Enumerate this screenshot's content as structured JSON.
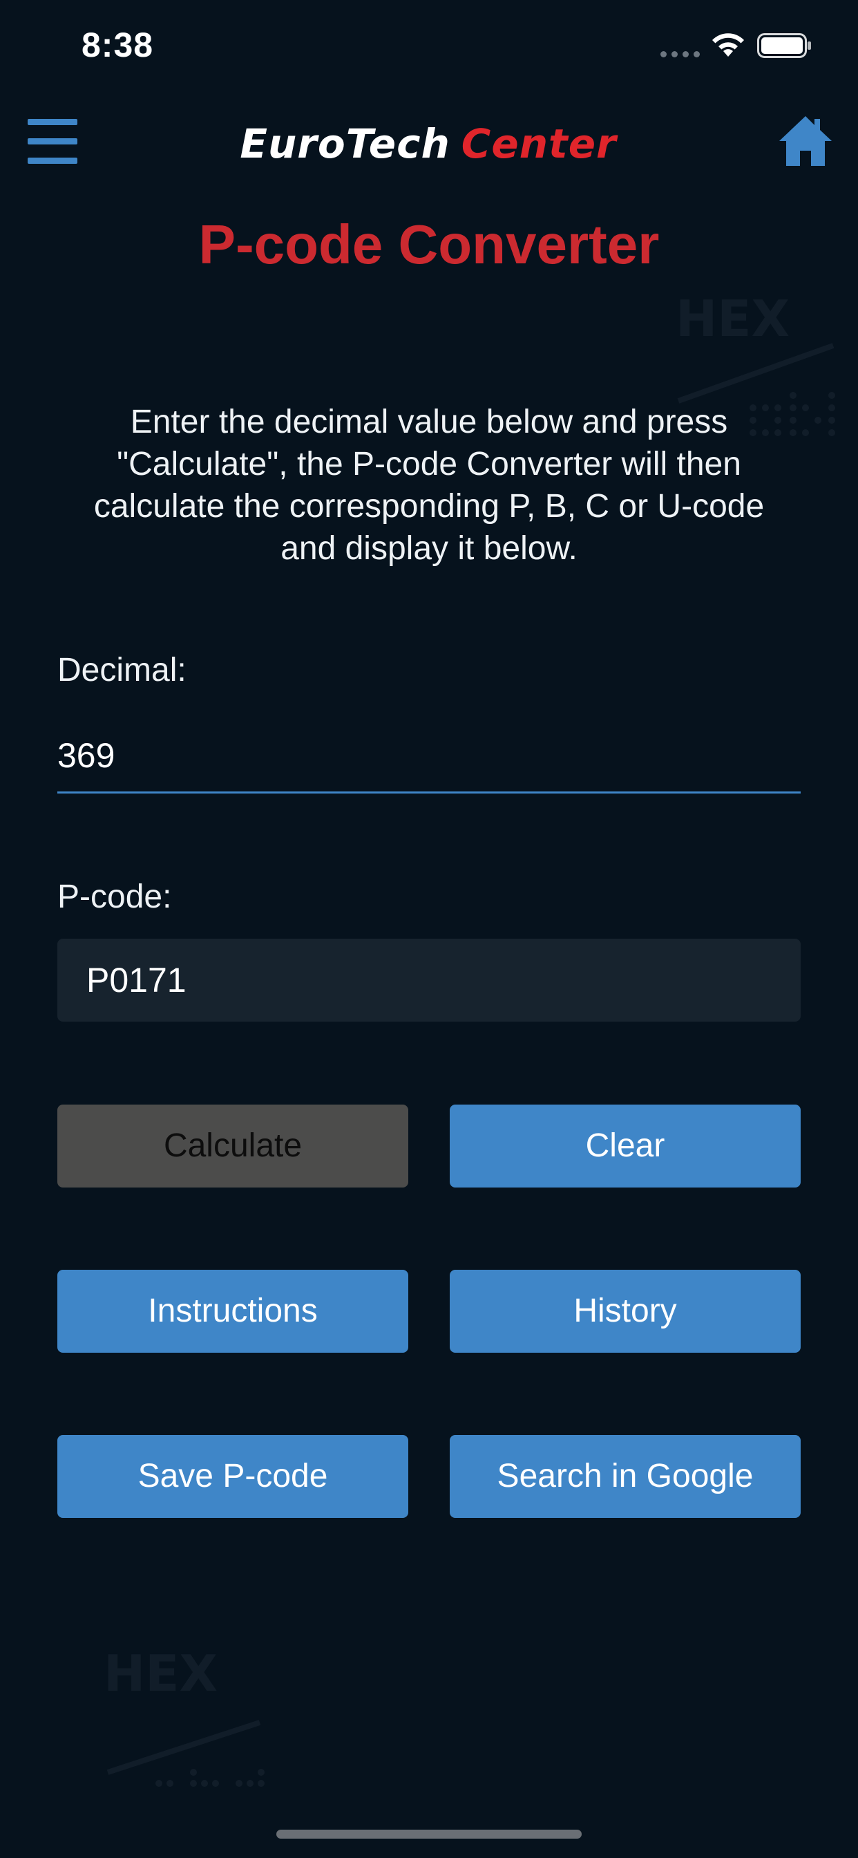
{
  "status_bar": {
    "time": "8:38"
  },
  "header": {
    "logo_part1": "EuroTech",
    "logo_part2": "Center",
    "menu_icon": "hamburger-menu-icon",
    "home_icon": "home-icon"
  },
  "page": {
    "title": "P-code Converter",
    "intro": "Enter the decimal value below and press \"Calculate\", the P-code Converter will then calculate the corresponding P, B, C or U-code and display it below."
  },
  "form": {
    "decimal_label": "Decimal:",
    "decimal_value": "369",
    "pcode_label": "P-code:",
    "pcode_value": "P0171"
  },
  "buttons": {
    "calculate": "Calculate",
    "clear": "Clear",
    "instructions": "Instructions",
    "history": "History",
    "save": "Save P-code",
    "search": "Search in Google"
  },
  "watermark": {
    "label": "HEX"
  },
  "colors": {
    "background": "#06121d",
    "accent_blue": "#3f86c8",
    "title_red": "#cc2a30",
    "logo_red": "#e0252b",
    "disabled_button": "#4c4c4b",
    "output_field": "#17232e"
  }
}
